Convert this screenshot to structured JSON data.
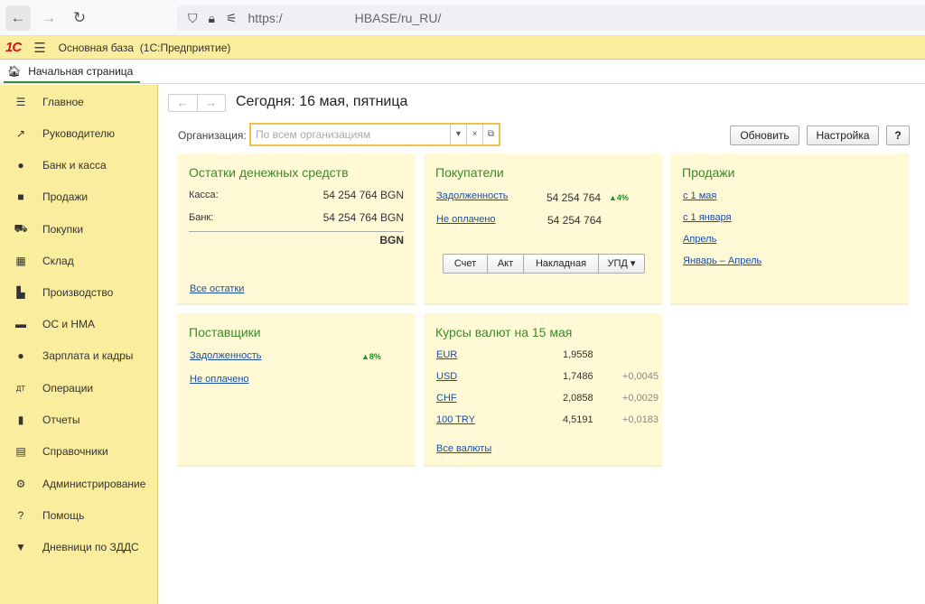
{
  "browser": {
    "url_prefix": "https:/",
    "url_suffix": "HBASE/ru_RU/"
  },
  "app": {
    "logo": "1С",
    "title": "Основная база",
    "subtitle": "(1С:Предприятие)"
  },
  "home_tab": {
    "label": "Начальная страница"
  },
  "sidebar": {
    "items": [
      {
        "label": "Главное",
        "icon": "menu-icon"
      },
      {
        "label": "Руководителю",
        "icon": "trend-icon"
      },
      {
        "label": "Банк и касса",
        "icon": "coin-icon"
      },
      {
        "label": "Продажи",
        "icon": "bag-icon"
      },
      {
        "label": "Покупки",
        "icon": "cart-icon"
      },
      {
        "label": "Склад",
        "icon": "warehouse-icon"
      },
      {
        "label": "Производство",
        "icon": "factory-icon"
      },
      {
        "label": "ОС и НМА",
        "icon": "truck-icon"
      },
      {
        "label": "Зарплата и кадры",
        "icon": "person-icon"
      },
      {
        "label": "Операции",
        "icon": "dt-kt-icon"
      },
      {
        "label": "Отчеты",
        "icon": "bar-chart-icon"
      },
      {
        "label": "Справочники",
        "icon": "books-icon"
      },
      {
        "label": "Администрирование",
        "icon": "gear-icon"
      },
      {
        "label": "Помощь",
        "icon": "question-icon"
      },
      {
        "label": "Дневници по ЗДДС",
        "icon": "chevron-down-icon"
      }
    ]
  },
  "main": {
    "today": "Сегодня: 16 мая, пятница",
    "org_label": "Организация:",
    "org_placeholder": "По всем организациям",
    "refresh": "Обновить",
    "settings": "Настройка",
    "help": "?"
  },
  "cash": {
    "title": "Остатки денежных средств",
    "kassa_label": "Касса:",
    "kassa_value": "54 254 764 BGN",
    "bank_label": "Банк:",
    "bank_value": "54 254 764 BGN",
    "total_currency": "BGN",
    "all_link": "Все остатки"
  },
  "buyers": {
    "title": "Покупатели",
    "debt_link": "Задолженность",
    "debt_value": "54 254 764",
    "debt_change": "▲4%",
    "unpaid_link": "Не оплачено",
    "unpaid_value": "54 254 764",
    "buttons": [
      "Счет",
      "Акт",
      "Накладная",
      "УПД"
    ]
  },
  "sales": {
    "title": "Продажи",
    "links": [
      "с 1 мая",
      "с 1 января",
      "Апрель",
      "Январь – Апрель"
    ]
  },
  "suppliers": {
    "title": "Поставщики",
    "debt_link": "Задолженность",
    "debt_change": "▲8%",
    "unpaid_link": "Не оплачено"
  },
  "currency": {
    "title": "Курсы валют на 15 мая",
    "rows": [
      {
        "code": "EUR",
        "rate": "1,9558",
        "change": ""
      },
      {
        "code": "USD",
        "rate": "1,7486",
        "change": "+0,0045"
      },
      {
        "code": "CHF",
        "rate": "2,0858",
        "change": "+0,0029"
      },
      {
        "code": "100 TRY",
        "rate": "4,5191",
        "change": "+0,0183"
      }
    ],
    "all_link": "Все валюты"
  }
}
